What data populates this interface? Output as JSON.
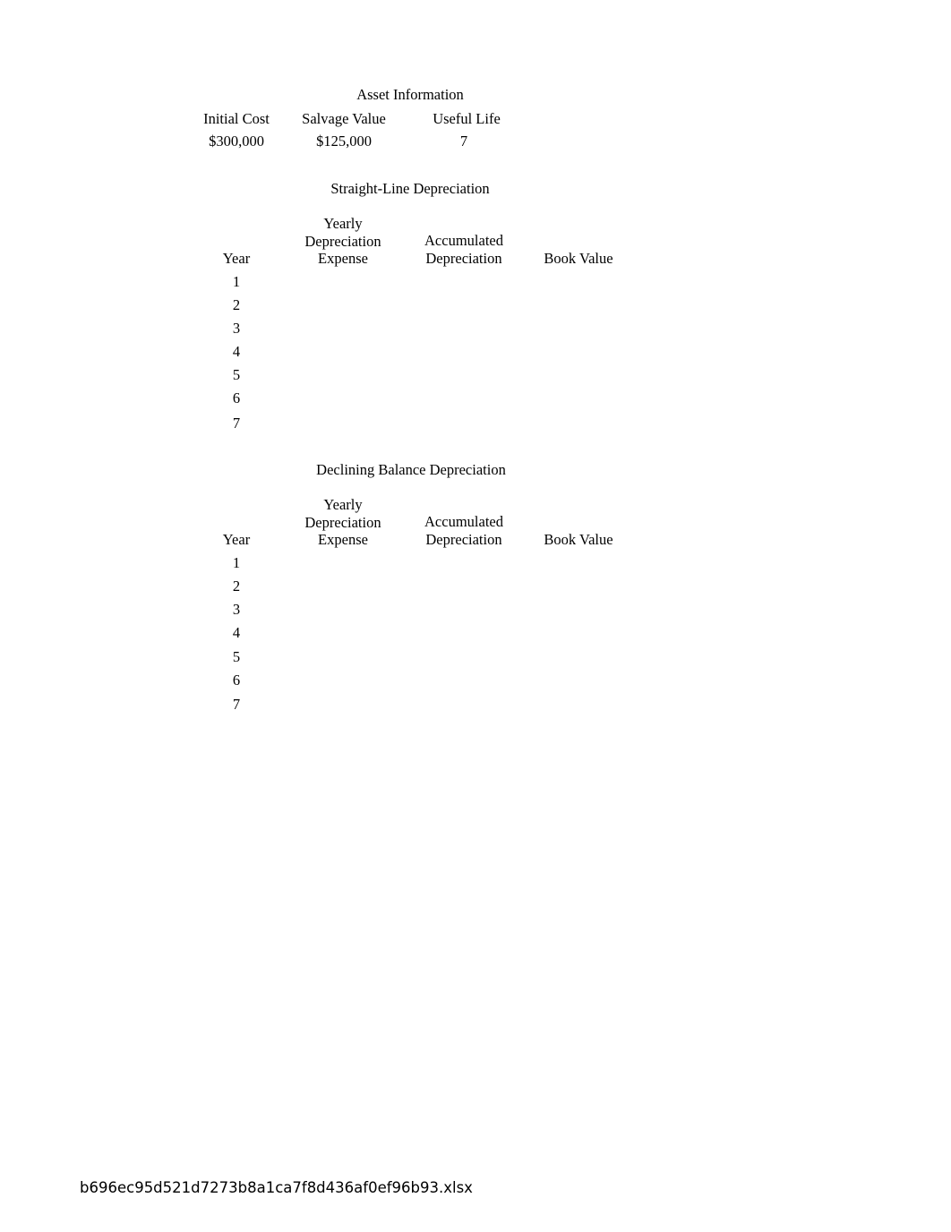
{
  "document": {
    "page_background": "#ffffff",
    "text_color": "#000000"
  },
  "asset_information": {
    "title": "Asset Information",
    "columns": [
      {
        "label": "Initial Cost",
        "value": "$300,000"
      },
      {
        "label": "Salvage Value",
        "value": "$125,000"
      },
      {
        "label": "Useful Life",
        "value": "7"
      }
    ]
  },
  "tables": [
    {
      "title": "Straight-Line Depreciation",
      "headers": [
        {
          "lines": [
            "Year"
          ]
        },
        {
          "lines": [
            "Yearly",
            "Depreciation",
            "Expense"
          ]
        },
        {
          "lines": [
            "Accumulated",
            "Depreciation"
          ]
        },
        {
          "lines": [
            "Book Value"
          ]
        }
      ],
      "rows": [
        {
          "year": "1",
          "yearly_depreciation_expense": "",
          "accumulated_depreciation": "",
          "book_value": ""
        },
        {
          "year": "2",
          "yearly_depreciation_expense": "",
          "accumulated_depreciation": "",
          "book_value": ""
        },
        {
          "year": "3",
          "yearly_depreciation_expense": "",
          "accumulated_depreciation": "",
          "book_value": ""
        },
        {
          "year": "4",
          "yearly_depreciation_expense": "",
          "accumulated_depreciation": "",
          "book_value": ""
        },
        {
          "year": "5",
          "yearly_depreciation_expense": "",
          "accumulated_depreciation": "",
          "book_value": ""
        },
        {
          "year": "6",
          "yearly_depreciation_expense": "",
          "accumulated_depreciation": "",
          "book_value": ""
        },
        {
          "year": "7",
          "yearly_depreciation_expense": "",
          "accumulated_depreciation": "",
          "book_value": ""
        }
      ]
    },
    {
      "title": "Declining Balance Depreciation",
      "headers": [
        {
          "lines": [
            "Year"
          ]
        },
        {
          "lines": [
            "Yearly",
            "Depreciation",
            "Expense"
          ]
        },
        {
          "lines": [
            "Accumulated",
            "Depreciation"
          ]
        },
        {
          "lines": [
            "Book Value"
          ]
        }
      ],
      "rows": [
        {
          "year": "1",
          "yearly_depreciation_expense": "",
          "accumulated_depreciation": "",
          "book_value": ""
        },
        {
          "year": "2",
          "yearly_depreciation_expense": "",
          "accumulated_depreciation": "",
          "book_value": ""
        },
        {
          "year": "3",
          "yearly_depreciation_expense": "",
          "accumulated_depreciation": "",
          "book_value": ""
        },
        {
          "year": "4",
          "yearly_depreciation_expense": "",
          "accumulated_depreciation": "",
          "book_value": ""
        },
        {
          "year": "5",
          "yearly_depreciation_expense": "",
          "accumulated_depreciation": "",
          "book_value": ""
        },
        {
          "year": "6",
          "yearly_depreciation_expense": "",
          "accumulated_depreciation": "",
          "book_value": ""
        },
        {
          "year": "7",
          "yearly_depreciation_expense": "",
          "accumulated_depreciation": "",
          "book_value": ""
        }
      ]
    }
  ],
  "footer": {
    "filename": "b696ec95d521d7273b8a1ca7f8d436af0ef96b93.xlsx"
  }
}
